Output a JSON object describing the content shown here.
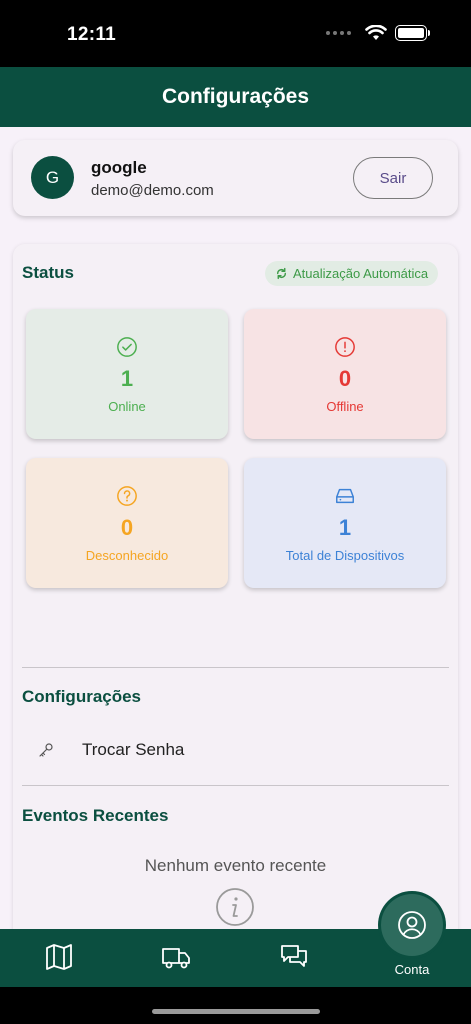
{
  "status_bar": {
    "time": "12:11"
  },
  "header": {
    "title": "Configurações"
  },
  "user": {
    "avatar_initial": "G",
    "name": "google",
    "email": "demo@demo.com",
    "logout_label": "Sair"
  },
  "status": {
    "title": "Status",
    "auto_update_label": "Atualização Automática",
    "cards": {
      "online": {
        "value": "1",
        "label": "Online",
        "color": "#4caf50"
      },
      "offline": {
        "value": "0",
        "label": "Offline",
        "color": "#e53935"
      },
      "unknown": {
        "value": "0",
        "label": "Desconhecido",
        "color": "#f5a522"
      },
      "total": {
        "value": "1",
        "label": "Total de Dispositivos",
        "color": "#3d82d6"
      }
    }
  },
  "settings": {
    "title": "Configurações",
    "items": [
      {
        "label": "Trocar Senha",
        "icon": "key-icon"
      }
    ]
  },
  "events": {
    "title": "Eventos Recentes",
    "empty_text": "Nenhum evento recente"
  },
  "bottom_nav": {
    "items": [
      {
        "icon": "map-icon"
      },
      {
        "icon": "truck-icon"
      },
      {
        "icon": "chat-icon"
      },
      {
        "icon": "account-icon",
        "label": "Conta",
        "active": true
      }
    ]
  },
  "colors": {
    "primary": "#0b4f40",
    "background": "#f7f1f9"
  }
}
